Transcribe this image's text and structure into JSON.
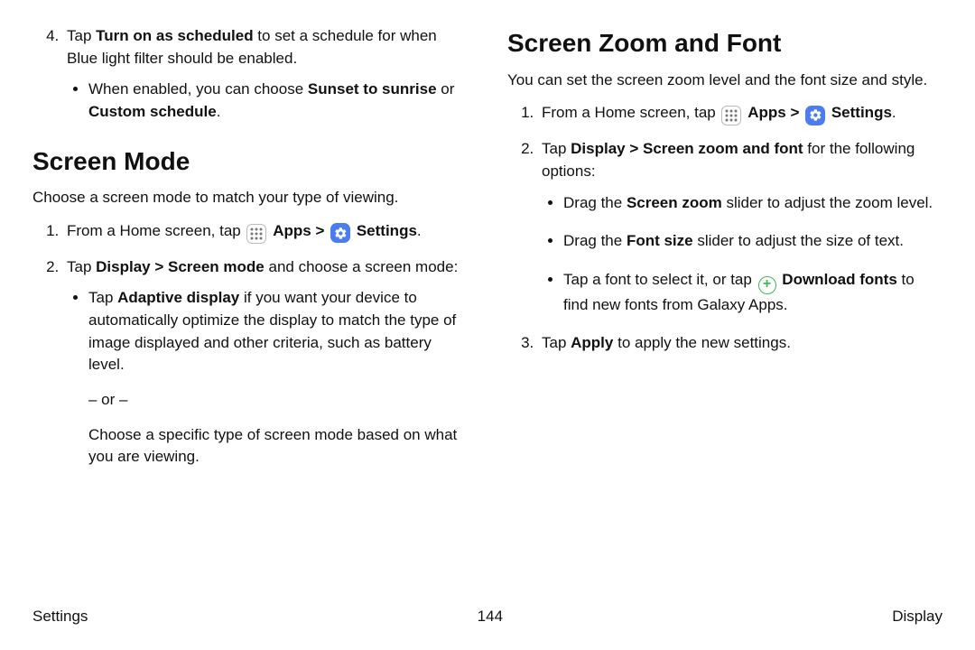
{
  "left": {
    "step4_pre": "Tap ",
    "step4_bold": "Turn on as scheduled",
    "step4_post": " to set a schedule for when Blue light filter should be enabled.",
    "step4_bullet_pre": "When enabled, you can choose ",
    "step4_bullet_bold1": "Sunset to sunrise",
    "step4_bullet_mid": " or ",
    "step4_bullet_bold2": "Custom schedule",
    "step4_bullet_end": ".",
    "h_screenmode": "Screen Mode",
    "screenmode_intro": "Choose a screen mode to match your type of viewing.",
    "sm1_pre": "From a Home screen, tap ",
    "apps_label": "Apps",
    "chev": ">",
    "settings_label": "Settings",
    "sm1_end": ".",
    "sm2_pre": "Tap ",
    "sm2_bold": "Display > Screen mode",
    "sm2_post": " and choose a screen mode:",
    "sm2_b1_pre": "Tap ",
    "sm2_b1_bold": "Adaptive display",
    "sm2_b1_post": " if you want your device to automatically optimize the display to match the type of image displayed and other criteria, such as battery level.",
    "or_line": "– or –",
    "sm2_b1_last": "Choose a specific type of screen mode based on what you are viewing."
  },
  "right": {
    "h_zoomfont": "Screen Zoom and Font",
    "zf_intro": "You can set the screen zoom level and the font size and style.",
    "zf1_pre": "From a Home screen, tap ",
    "apps_label": "Apps",
    "chev": ">",
    "settings_label": "Settings",
    "zf1_end": ".",
    "zf2_pre": "Tap ",
    "zf2_bold": "Display > Screen zoom and font",
    "zf2_post": " for the following options:",
    "zf2_b1_pre": "Drag the ",
    "zf2_b1_bold": "Screen zoom",
    "zf2_b1_post": " slider to adjust the zoom level.",
    "zf2_b2_pre": "Drag the ",
    "zf2_b2_bold": "Font size",
    "zf2_b2_post": " slider to adjust the size of text.",
    "zf2_b3_pre": "Tap a font to select it, or tap ",
    "zf2_b3_bold": "Download fonts",
    "zf2_b3_post": " to find new fonts from Galaxy Apps.",
    "zf3_pre": "Tap ",
    "zf3_bold": "Apply",
    "zf3_post": " to apply the new settings."
  },
  "footer": {
    "left": "Settings",
    "page": "144",
    "right": "Display"
  }
}
